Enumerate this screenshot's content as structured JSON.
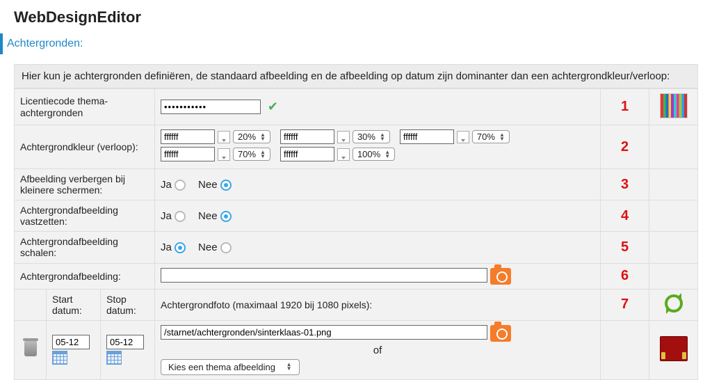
{
  "page_title": "WebDesignEditor",
  "section": "Achtergronden:",
  "help_text": "Hier kun je achtergronden definiëren, de standaard afbeelding en de afbeelding op datum zijn dominanter dan een achtergrondkleur/verloop:",
  "rows": {
    "license": {
      "label": "Licentiecode thema-achtergronden",
      "value": "•••••••••••",
      "num": "1"
    },
    "gradient": {
      "label": "Achtergrondkleur (verloop):",
      "num": "2",
      "stops": [
        {
          "color": "ffffff",
          "pct": "20%"
        },
        {
          "color": "ffffff",
          "pct": "30%"
        },
        {
          "color": "ffffff",
          "pct": "70%"
        },
        {
          "color": "ffffff",
          "pct": "70%"
        },
        {
          "color": "ffffff",
          "pct": "100%"
        }
      ]
    },
    "hide_small": {
      "label": "Afbeelding verbergen bij kleinere schermen:",
      "ja": "Ja",
      "nee": "Nee",
      "value": "Nee",
      "num": "3"
    },
    "fix_bg": {
      "label": "Achtergrondafbeelding vastzetten:",
      "ja": "Ja",
      "nee": "Nee",
      "value": "Nee",
      "num": "4"
    },
    "scale_bg": {
      "label": "Achtergrondafbeelding schalen:",
      "ja": "Ja",
      "nee": "Nee",
      "value": "Ja",
      "num": "5"
    },
    "bg_image": {
      "label": "Achtergrondafbeelding:",
      "value": "",
      "num": "6"
    },
    "dated": {
      "start_label": "Start datum:",
      "stop_label": "Stop datum:",
      "photo_label": "Achtergrondfoto (maximaal 1920 bij 1080 pixels):",
      "num": "7",
      "entry": {
        "start": "05-12",
        "stop": "05-12",
        "path": "/starnet/achtergronden/sinterklaas-01.png",
        "of": "of",
        "theme_select": "Kies een thema afbeelding"
      }
    }
  }
}
